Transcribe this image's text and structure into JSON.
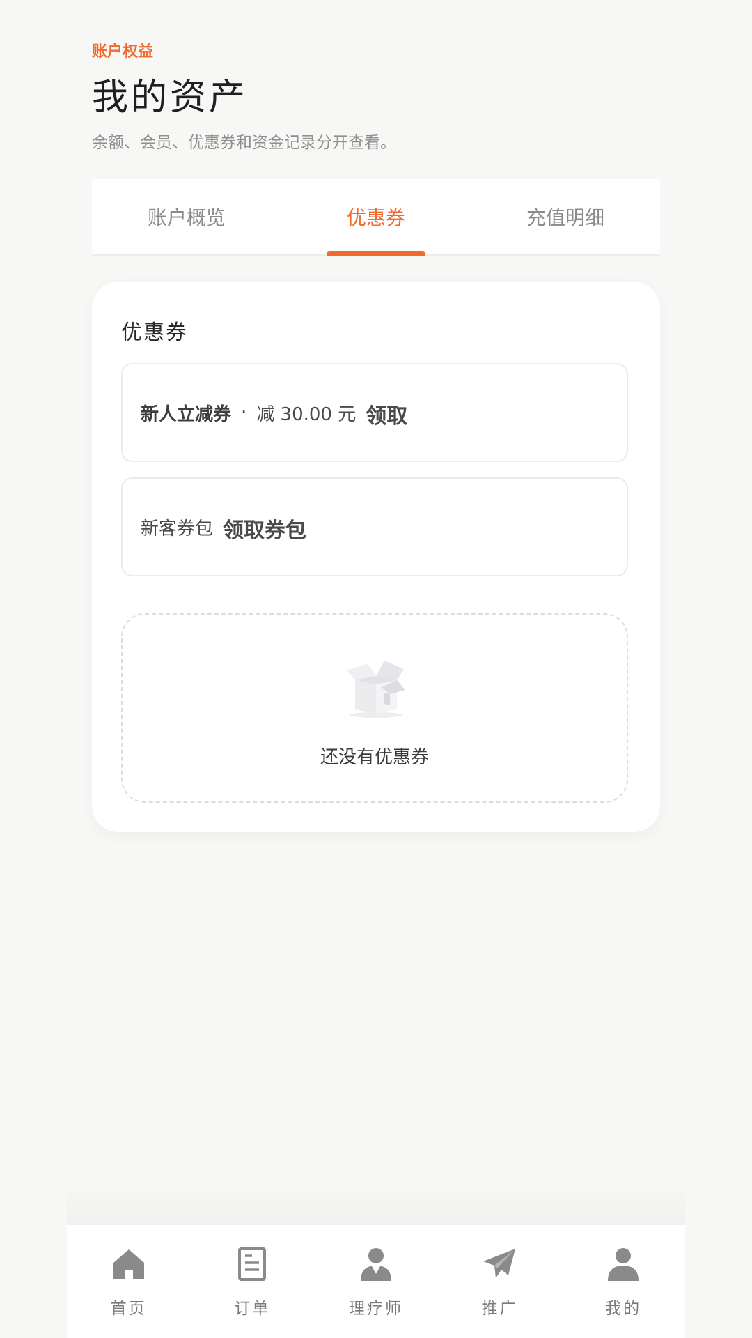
{
  "header": {
    "eyebrow": "账户权益",
    "title": "我的资产",
    "subtitle": "余额、会员、优惠券和资金记录分开查看。"
  },
  "tabs": [
    {
      "label": "账户概览",
      "active": false
    },
    {
      "label": "优惠券",
      "active": true
    },
    {
      "label": "充值明细",
      "active": false
    }
  ],
  "colors": {
    "accent": "#f26a2b",
    "background": "#f7f7f6",
    "card": "#ffffff"
  },
  "coupon_section": {
    "title": "优惠券",
    "coupons": [
      {
        "name": "新人立减券",
        "separator": "·",
        "amount": "减 30.00 元",
        "action": "领取"
      },
      {
        "name": "新客券包",
        "action": "领取券包"
      }
    ],
    "empty_text": "还没有优惠券"
  },
  "bottom_nav": [
    {
      "label": "首页",
      "icon": "home-icon"
    },
    {
      "label": "订单",
      "icon": "order-document-icon"
    },
    {
      "label": "理疗师",
      "icon": "therapist-person-icon"
    },
    {
      "label": "推广",
      "icon": "paper-plane-icon"
    },
    {
      "label": "我的",
      "icon": "user-profile-icon"
    }
  ]
}
